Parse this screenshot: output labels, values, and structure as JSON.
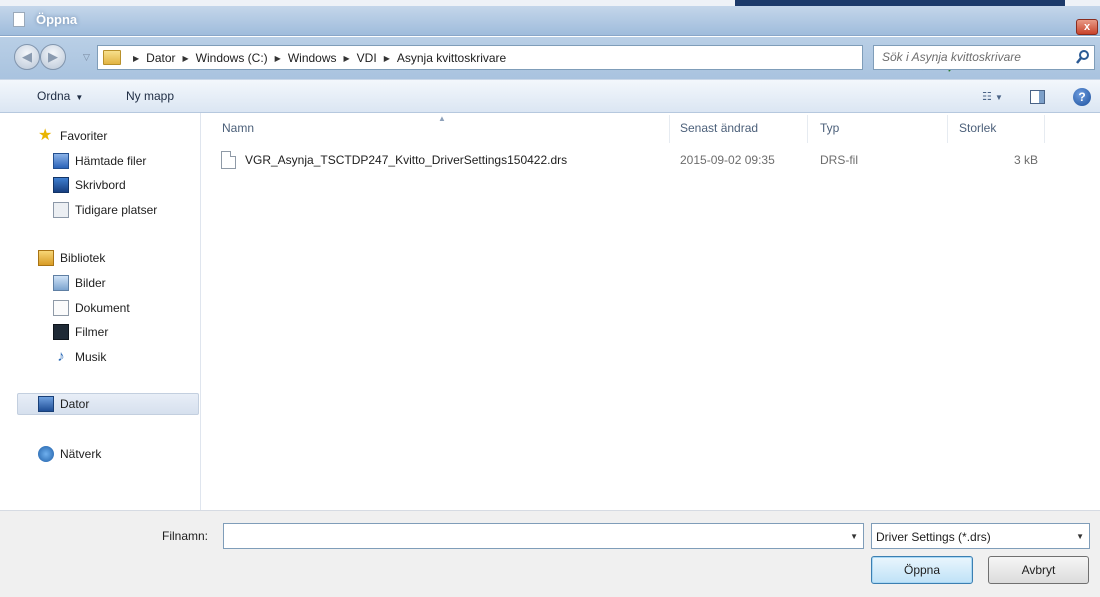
{
  "window": {
    "title": "Öppna",
    "close_label": "x"
  },
  "address": {
    "crumbs": [
      "Dator",
      "Windows (C:)",
      "Windows",
      "VDI",
      "Asynja kvittoskrivare"
    ]
  },
  "search": {
    "placeholder": "Sök i Asynja kvittoskrivare"
  },
  "toolbar": {
    "organize_label": "Ordna",
    "new_folder_label": "Ny mapp",
    "view_label": "☷",
    "help_label": "?"
  },
  "nav": {
    "favorites": "Favoriter",
    "downloads": "Hämtade filer",
    "desktop": "Skrivbord",
    "recent": "Tidigare platser",
    "libraries": "Bibliotek",
    "pictures": "Bilder",
    "documents": "Dokument",
    "videos": "Filmer",
    "music": "Musik",
    "computer": "Dator",
    "network": "Nätverk"
  },
  "columns": {
    "name": "Namn",
    "date": "Senast ändrad",
    "type": "Typ",
    "size": "Storlek"
  },
  "files": [
    {
      "name": "VGR_Asynja_TSCTDP247_Kvitto_DriverSettings150422.drs",
      "date": "2015-09-02 09:35",
      "type": "DRS-fil",
      "size": "3 kB"
    }
  ],
  "footer": {
    "filename_label": "Filnamn:",
    "filename_value": "",
    "filetype_value": "Driver Settings (*.drs)",
    "open_label": "Öppna",
    "cancel_label": "Avbryt"
  }
}
